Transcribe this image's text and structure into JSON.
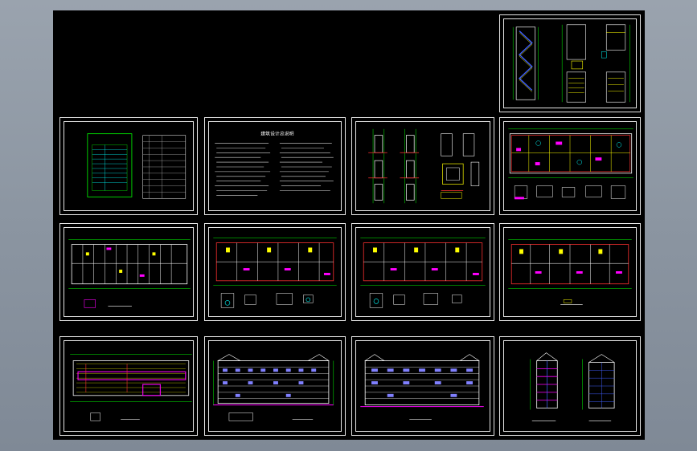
{
  "viewport": {
    "background": "#000000",
    "frame_color": "#e6e6e6"
  },
  "sheets": [
    {
      "id": "stair-details",
      "label": "stair-detail-sheet"
    },
    {
      "id": "drawing-index",
      "label": "drawing-index-sheet"
    },
    {
      "id": "design-notes",
      "label": "design-notes-sheet",
      "notes_title": "建筑设计总说明"
    },
    {
      "id": "wall-details",
      "label": "wall-details-sheet"
    },
    {
      "id": "plan-1",
      "label": "floor-plan-sheet-1"
    },
    {
      "id": "plan-2",
      "label": "floor-plan-sheet-2"
    },
    {
      "id": "plan-3",
      "label": "floor-plan-sheet-3"
    },
    {
      "id": "plan-4",
      "label": "floor-plan-sheet-4"
    },
    {
      "id": "plan-5",
      "label": "floor-plan-sheet-5"
    },
    {
      "id": "roof-plan",
      "label": "roof-plan-sheet"
    },
    {
      "id": "elev-1",
      "label": "front-elevation-sheet"
    },
    {
      "id": "elev-2",
      "label": "rear-elevation-sheet"
    },
    {
      "id": "sections",
      "label": "section-sheet"
    }
  ],
  "colors": {
    "yellow": "#ffff00",
    "green": "#00ff00",
    "cyan": "#00ffff",
    "magenta": "#ff00ff",
    "red": "#ff3030",
    "white": "#ffffff",
    "blue": "#4060ff"
  }
}
